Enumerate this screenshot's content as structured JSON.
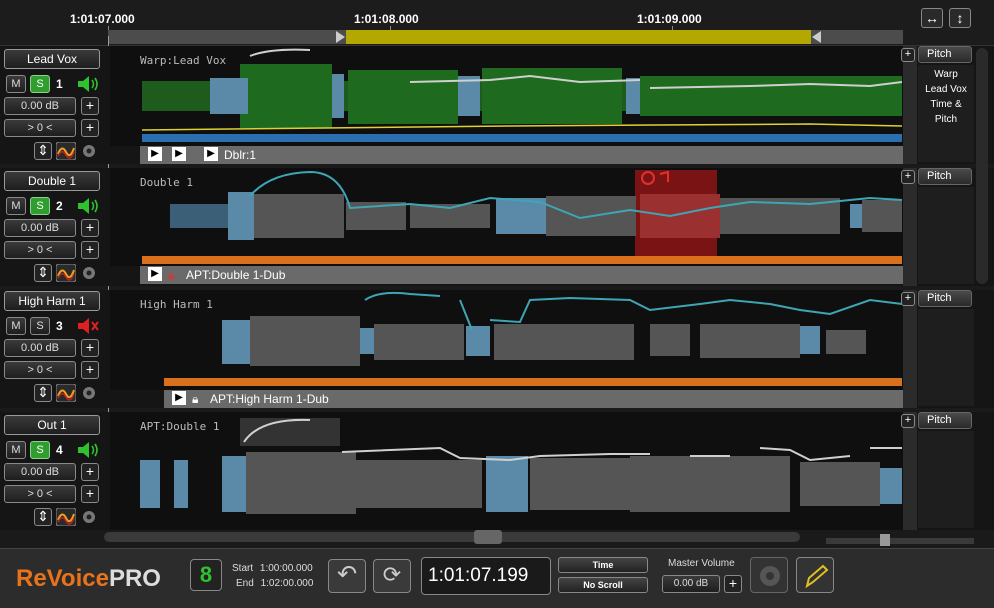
{
  "timeline": {
    "times": [
      "1:01:07.000",
      "1:01:08.000",
      "1:01:09.000"
    ],
    "fit_h_icon": "↔",
    "fit_v_icon": "↕"
  },
  "tracks": [
    {
      "name": "Lead Vox",
      "mute_label": "M",
      "solo_label": "S",
      "number": "1",
      "solo_on": true,
      "gain": "0.00 dB",
      "offset": "> 0 <",
      "wave_label": "Warp:Lead Vox",
      "bar_label": "Dblr:1",
      "pitch_label": "Pitch",
      "info": [
        "Warp",
        "Lead Vox",
        "Time &",
        "Pitch"
      ],
      "speaker": "on"
    },
    {
      "name": "Double 1",
      "mute_label": "M",
      "solo_label": "S",
      "number": "2",
      "solo_on": true,
      "gain": "0.00 dB",
      "offset": "> 0 <",
      "wave_label": "Double 1",
      "bar_label": "APT:Double 1-Dub",
      "pitch_label": "Pitch",
      "speaker": "on"
    },
    {
      "name": "High Harm 1",
      "mute_label": "M",
      "solo_label": "S",
      "number": "3",
      "solo_on": false,
      "gain": "0.00 dB",
      "offset": "> 0 <",
      "wave_label": "High Harm 1",
      "bar_label": "APT:High Harm 1-Dub",
      "pitch_label": "Pitch",
      "speaker": "muted"
    },
    {
      "name": "Out 1",
      "mute_label": "M",
      "solo_label": "S",
      "number": "4",
      "solo_on": true,
      "gain": "0.00 dB",
      "offset": "> 0 <",
      "wave_label": "APT:Double 1",
      "pitch_label": "Pitch",
      "speaker": "on"
    }
  ],
  "transport": {
    "logo_re": "ReVoice",
    "logo_pro": "PRO",
    "start_label": "Start",
    "start_value": "1:00:00.000",
    "end_label": "End",
    "end_value": "1:02:00.000",
    "timecode": "1:01:07.199",
    "time_mode": "Time",
    "scroll_mode": "No Scroll",
    "master_volume_label": "Master Volume",
    "master_volume_value": "0.00 dB"
  },
  "colors": {
    "solo_green": "#2f9e2f",
    "selection_yellow": "#b4a800",
    "pitch_cyan": "#3fa5b5",
    "orange_level": "#d9701c",
    "logo_orange": "#e8731a",
    "region_red": "#8a1515"
  }
}
